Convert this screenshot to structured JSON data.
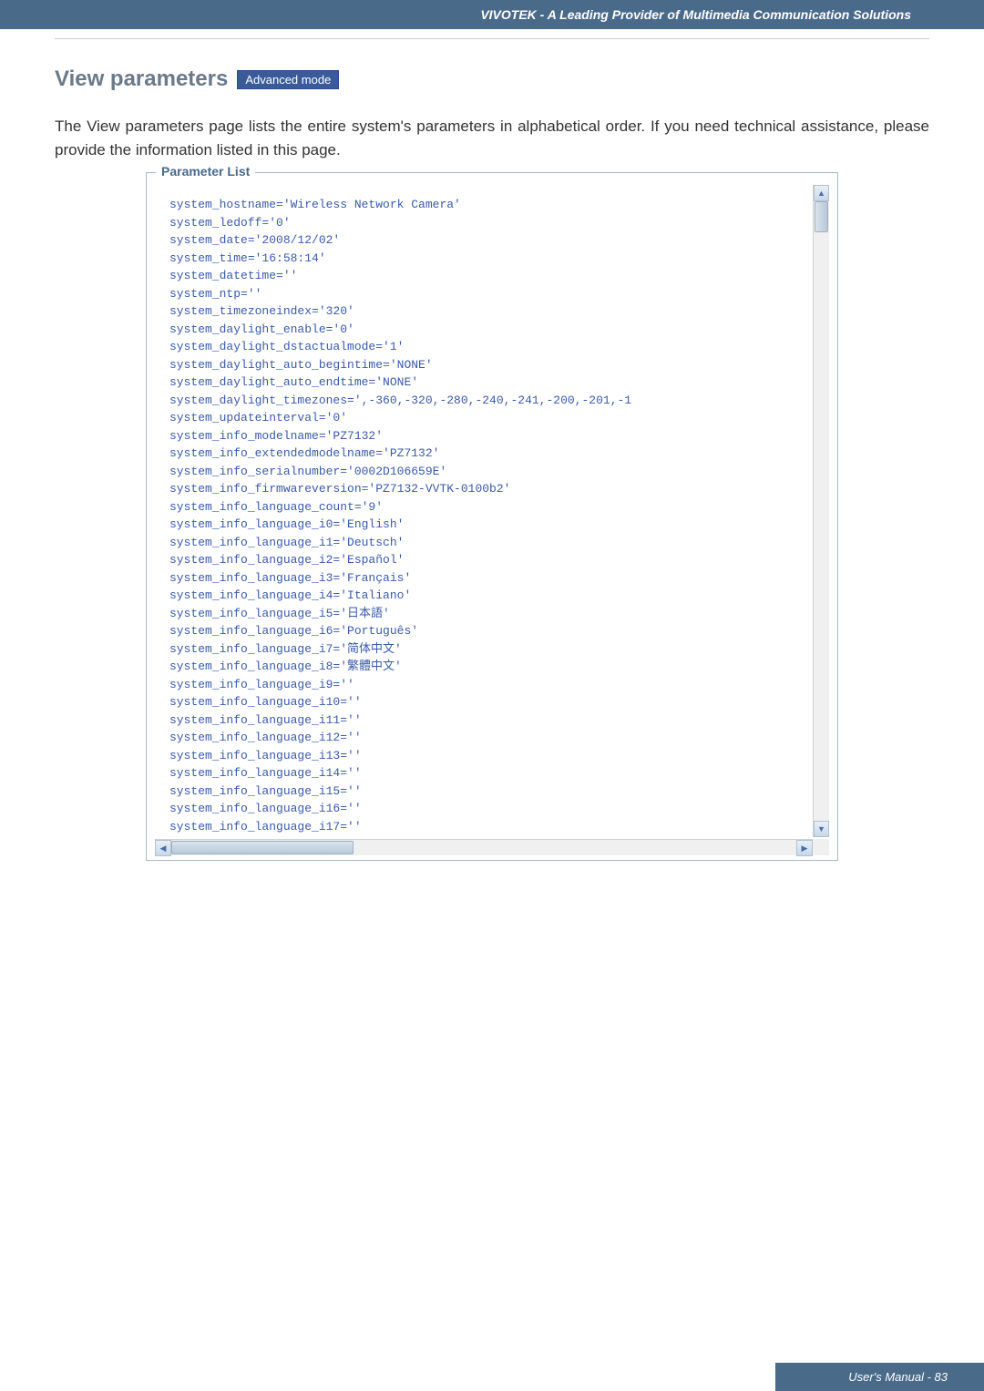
{
  "header": {
    "title": "VIVOTEK - A Leading Provider of Multimedia Communication Solutions"
  },
  "section": {
    "title": "View parameters",
    "badge": "Advanced mode"
  },
  "description": "The View parameters page lists the entire system's parameters in alphabetical order. If you need technical assistance, please provide the information listed in this page.",
  "panel": {
    "legend": "Parameter List",
    "parameters": "system_hostname='Wireless Network Camera'\nsystem_ledoff='0'\nsystem_date='2008/12/02'\nsystem_time='16:58:14'\nsystem_datetime=''\nsystem_ntp=''\nsystem_timezoneindex='320'\nsystem_daylight_enable='0'\nsystem_daylight_dstactualmode='1'\nsystem_daylight_auto_begintime='NONE'\nsystem_daylight_auto_endtime='NONE'\nsystem_daylight_timezones=',-360,-320,-280,-240,-241,-200,-201,-1\nsystem_updateinterval='0'\nsystem_info_modelname='PZ7132'\nsystem_info_extendedmodelname='PZ7132'\nsystem_info_serialnumber='0002D106659E'\nsystem_info_firmwareversion='PZ7132-VVTK-0100b2'\nsystem_info_language_count='9'\nsystem_info_language_i0='English'\nsystem_info_language_i1='Deutsch'\nsystem_info_language_i2='Español'\nsystem_info_language_i3='Français'\nsystem_info_language_i4='Italiano'\nsystem_info_language_i5='日本語'\nsystem_info_language_i6='Português'\nsystem_info_language_i7='简体中文'\nsystem_info_language_i8='繁體中文'\nsystem_info_language_i9=''\nsystem_info_language_i10=''\nsystem_info_language_i11=''\nsystem_info_language_i12=''\nsystem_info_language_i13=''\nsystem_info_language_i14=''\nsystem_info_language_i15=''\nsystem_info_language_i16=''\nsystem_info_language_i17=''"
  },
  "footer": {
    "text": "User's Manual - 83"
  }
}
